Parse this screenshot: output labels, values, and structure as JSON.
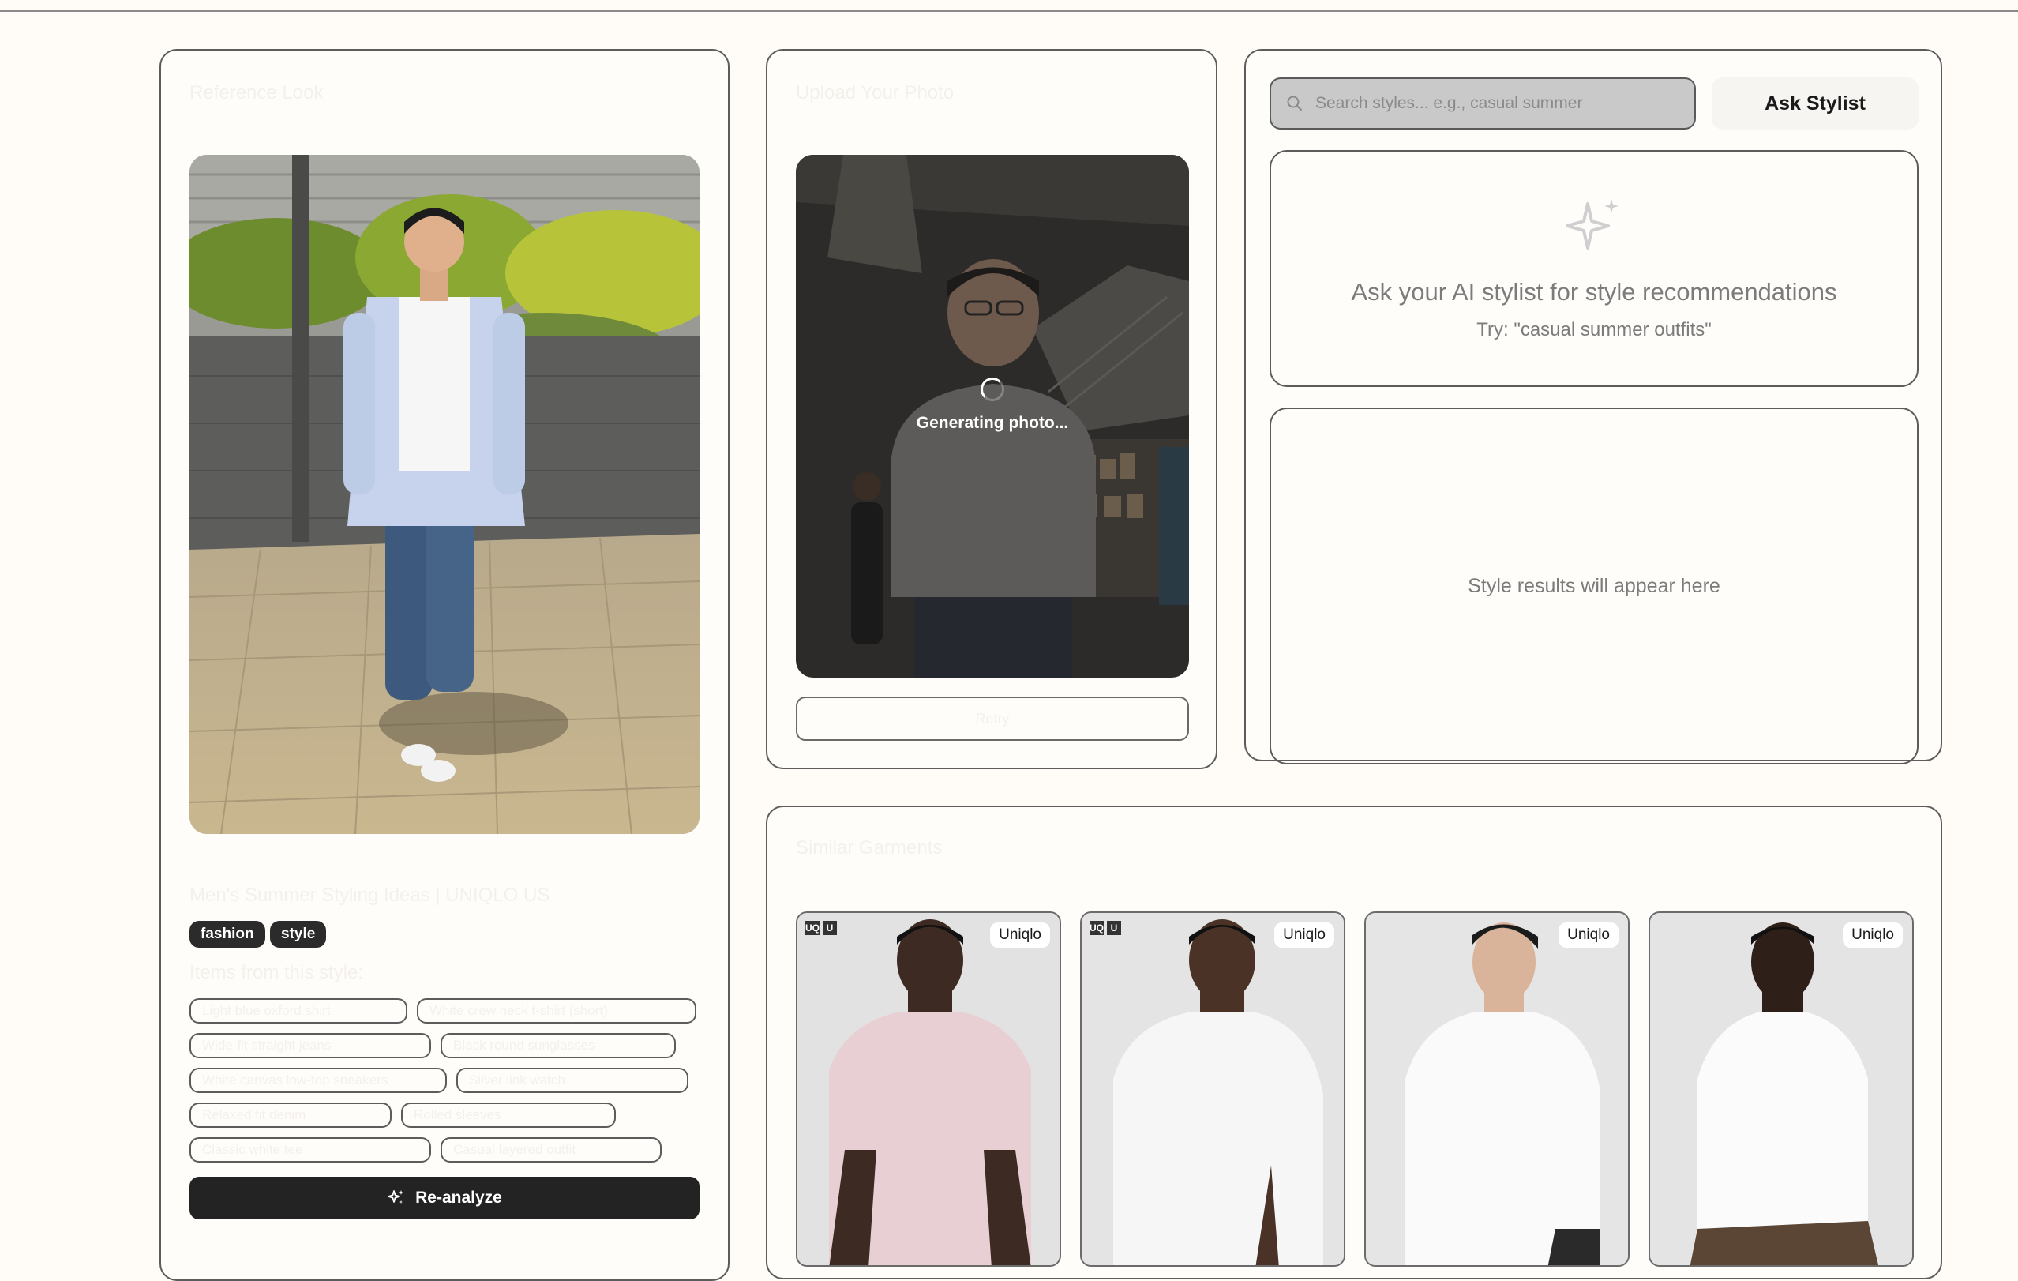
{
  "reference": {
    "title": "Reference Look",
    "caption": "Men's Summer Styling Ideas | UNIQLO US",
    "tags": [
      "fashion",
      "style"
    ],
    "items_label": "Items from this style:",
    "chips": [
      "Light blue oxford shirt",
      "White crew neck t-shirt (short)",
      "Wide-fit straight jeans",
      "Black round sunglasses",
      "White canvas low-top sneakers",
      "Silver link watch",
      "Relaxed fit denim",
      "Rolled sleeves",
      "Classic white tee",
      "Casual layered outfit"
    ],
    "reanalyze_label": "Re-analyze"
  },
  "upload": {
    "title": "Upload Your Photo",
    "generating_text": "Generating photo...",
    "button_label": "Retry"
  },
  "stylist": {
    "search_placeholder": "Search styles... e.g., casual summer",
    "ask_label": "Ask Stylist",
    "reco_title": "Ask your AI stylist for style recommendations",
    "reco_sub": "Try: \"casual summer outfits\"",
    "results_text": "Style results will appear here"
  },
  "garments": {
    "title": "Similar Garments",
    "cards": [
      {
        "brand": "Uniqlo",
        "shirt_color": "#e8cfd4",
        "skin": "#3d2a22",
        "logo": true
      },
      {
        "brand": "Uniqlo",
        "shirt_color": "#f6f6f6",
        "skin": "#4a3226",
        "logo": true
      },
      {
        "brand": "Uniqlo",
        "shirt_color": "#fafafa",
        "skin": "#d9b49a",
        "logo": false
      },
      {
        "brand": "Uniqlo",
        "shirt_color": "#fbfbfb",
        "skin": "#2e1f19",
        "logo": false
      }
    ]
  },
  "colors": {
    "page_bg": "#fffcf7",
    "dark_button": "#232323",
    "muted_text": "#7b7b7b"
  }
}
